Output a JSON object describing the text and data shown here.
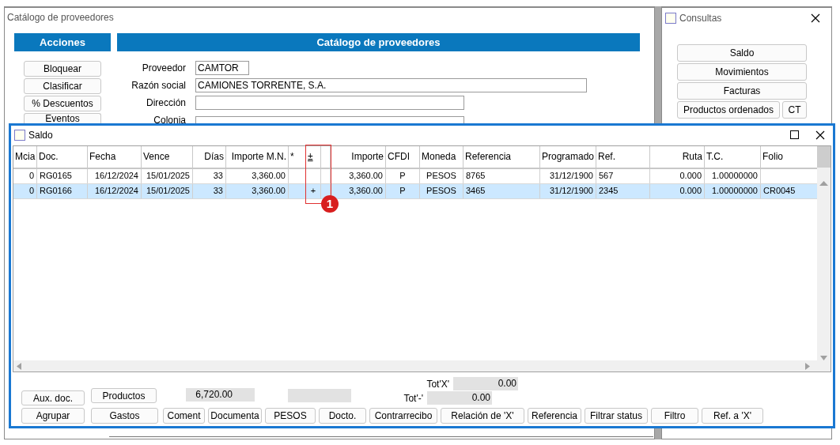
{
  "main_window": {
    "title": "Catálogo de proveedores",
    "actions_header": "Acciones",
    "actions": [
      "Bloquear",
      "Clasificar",
      "% Descuentos",
      "Eventos"
    ],
    "form_header": "Catálogo de proveedores",
    "fields": [
      {
        "label": "Proveedor",
        "value": "CAMTOR"
      },
      {
        "label": "Razón social",
        "value": "CAMIONES TORRENTE, S.A."
      },
      {
        "label": "Dirección"
      },
      {
        "label": "Colonia"
      }
    ]
  },
  "consultas_window": {
    "title": "Consultas",
    "buttons": [
      "Saldo",
      "Movimientos",
      "Facturas"
    ],
    "last_row": [
      "Productos ordenados",
      "CT"
    ]
  },
  "saldo_window": {
    "title": "Saldo",
    "table": {
      "columns": [
        {
          "label": "Mcia"
        },
        {
          "label": "Doc."
        },
        {
          "label": "Fecha"
        },
        {
          "label": "Vence"
        },
        {
          "label": "Días"
        },
        {
          "label": "Importe M.N."
        },
        {
          "label": "*"
        },
        {
          "label": "±"
        },
        {},
        {
          "label": "Importe"
        },
        {
          "label": "CFDI"
        },
        {
          "label": "Moneda"
        },
        {
          "label": "Referencia"
        },
        {
          "label": "Programado"
        },
        {
          "label": "Ref."
        },
        {
          "label": "Ruta"
        },
        {
          "label": "T.C."
        },
        {
          "label": "Folio"
        }
      ],
      "rows": [
        {
          "selected": false,
          "cells": [
            "0",
            "RG0165",
            "16/12/2024",
            "15/01/2025",
            "33",
            "3,360.00",
            null,
            null,
            null,
            "3,360.00",
            "P",
            "PESOS",
            "8765",
            "31/12/1900",
            "567",
            "0.000",
            "1.00000000",
            null
          ]
        },
        {
          "selected": true,
          "cells": [
            "0",
            "RG0166",
            "16/12/2024",
            "15/01/2025",
            "33",
            "3,360.00",
            null,
            "+",
            null,
            "3,360.00",
            "P",
            "PESOS",
            "3465",
            "31/12/1900",
            "2345",
            "0.000",
            "1.00000000",
            "CR0045"
          ]
        }
      ]
    },
    "top_buttons": [
      "Aux. doc.",
      "Productos"
    ],
    "total_mn": "6,720.00",
    "totals": [
      {
        "label": "Tot'X'",
        "value": "0.00"
      },
      {
        "label": "Tot'-'",
        "value": "0.00"
      }
    ],
    "buttons": [
      "Agrupar",
      "Gastos",
      "Coment",
      "Documenta",
      "PESOS",
      "Docto.",
      "Contrarrecibo",
      "Relación de 'X'",
      "Referencia",
      "Filtrar status",
      "Filtro",
      "Ref. a 'X'"
    ]
  },
  "annotation": {
    "label": "1"
  }
}
